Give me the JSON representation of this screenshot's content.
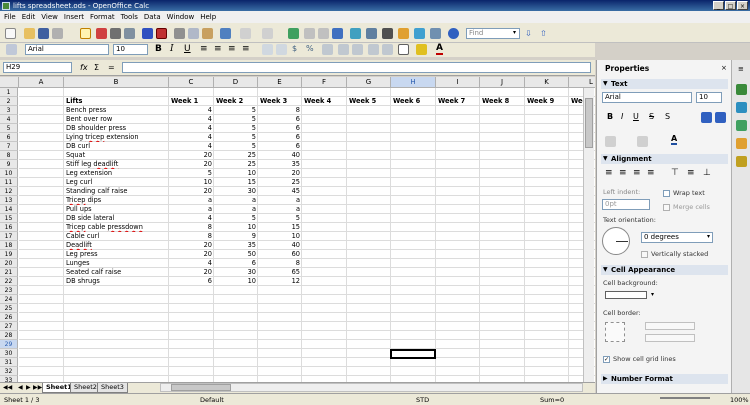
{
  "window": {
    "title": "lifts spreadsheet.ods - OpenOffice Calc",
    "controls": [
      "_",
      "□",
      "×"
    ]
  },
  "menu": [
    "File",
    "Edit",
    "View",
    "Insert",
    "Format",
    "Tools",
    "Data",
    "Window",
    "Help"
  ],
  "toolbar": {
    "find_placeholder": "Find",
    "font_name": "Arial",
    "font_size": "10"
  },
  "formula": {
    "name_box": "H29",
    "fx": "fx",
    "sigma": "Σ",
    "equals": "=",
    "content": ""
  },
  "columns": [
    "A",
    "B",
    "C",
    "D",
    "E",
    "F",
    "G",
    "H",
    "I",
    "J",
    "K",
    "L"
  ],
  "rows": [
    "1",
    "2",
    "3",
    "4",
    "5",
    "6",
    "7",
    "8",
    "9",
    "10",
    "11",
    "12",
    "13",
    "14",
    "15",
    "16",
    "17",
    "18",
    "19",
    "20",
    "21",
    "22",
    "23",
    "24",
    "25",
    "26",
    "27",
    "28",
    "29",
    "30",
    "31",
    "32",
    "33"
  ],
  "sheet": {
    "header": [
      "Lifts",
      "Week 1",
      "Week 2",
      "Week 3",
      "Week 4",
      "Week 5",
      "Week 6",
      "Week 7",
      "Week 8",
      "Week 9",
      "Wee"
    ],
    "data": [
      [
        "Bench press",
        "4",
        "5",
        "8"
      ],
      [
        "Bent over row",
        "4",
        "5",
        "6"
      ],
      [
        "DB shoulder press",
        "4",
        "5",
        "6"
      ],
      [
        "Lying tricep extension",
        "4",
        "5",
        "6"
      ],
      [
        "DB curl",
        "4",
        "5",
        "6"
      ],
      [
        "Squat",
        "20",
        "25",
        "40"
      ],
      [
        "Stiff leg deadlift",
        "20",
        "25",
        "35"
      ],
      [
        "Leg extension",
        "5",
        "10",
        "20"
      ],
      [
        "Leg curl",
        "10",
        "15",
        "25"
      ],
      [
        "Standing calf raise",
        "20",
        "30",
        "45"
      ],
      [
        "Tricep dips",
        "a",
        "a",
        "a"
      ],
      [
        "Pull ups",
        "a",
        "a",
        "a"
      ],
      [
        "DB side lateral",
        "4",
        "5",
        "5"
      ],
      [
        "Tricep cable pressdown",
        "8",
        "10",
        "15"
      ],
      [
        "Cable curl",
        "8",
        "9",
        "10"
      ],
      [
        "Deadlift",
        "20",
        "35",
        "40"
      ],
      [
        "Leg press",
        "20",
        "50",
        "60"
      ],
      [
        "Lunges",
        "4",
        "6",
        "8"
      ],
      [
        "Seated calf raise",
        "20",
        "30",
        "65"
      ],
      [
        "DB shrugs",
        "6",
        "10",
        "12"
      ]
    ],
    "misspelled": [
      "tricep",
      "deadlift",
      "Tricep",
      "pressdown",
      "Deadlift"
    ]
  },
  "tabs": [
    "Sheet1",
    "Sheet2",
    "Sheet3"
  ],
  "status": {
    "sheet": "Sheet 1 / 3",
    "style": "Default",
    "mode": "STD",
    "sum": "Sum=0",
    "zoom": "100%"
  },
  "sidebar": {
    "title": "Properties",
    "sections": {
      "text": "Text",
      "alignment": "Alignment",
      "cell_appearance": "Cell Appearance",
      "number_format": "Number Format"
    },
    "font_name": "Arial",
    "font_size": "10",
    "left_indent_label": "Left indent:",
    "left_indent_value": "0pt",
    "wrap_text": "Wrap text",
    "merge_cells": "Merge cells",
    "text_orientation": "Text orientation:",
    "degrees": "0 degrees",
    "vertically_stacked": "Vertically stacked",
    "cell_background": "Cell background:",
    "cell_border": "Cell border:",
    "show_grid": "Show cell grid lines"
  }
}
